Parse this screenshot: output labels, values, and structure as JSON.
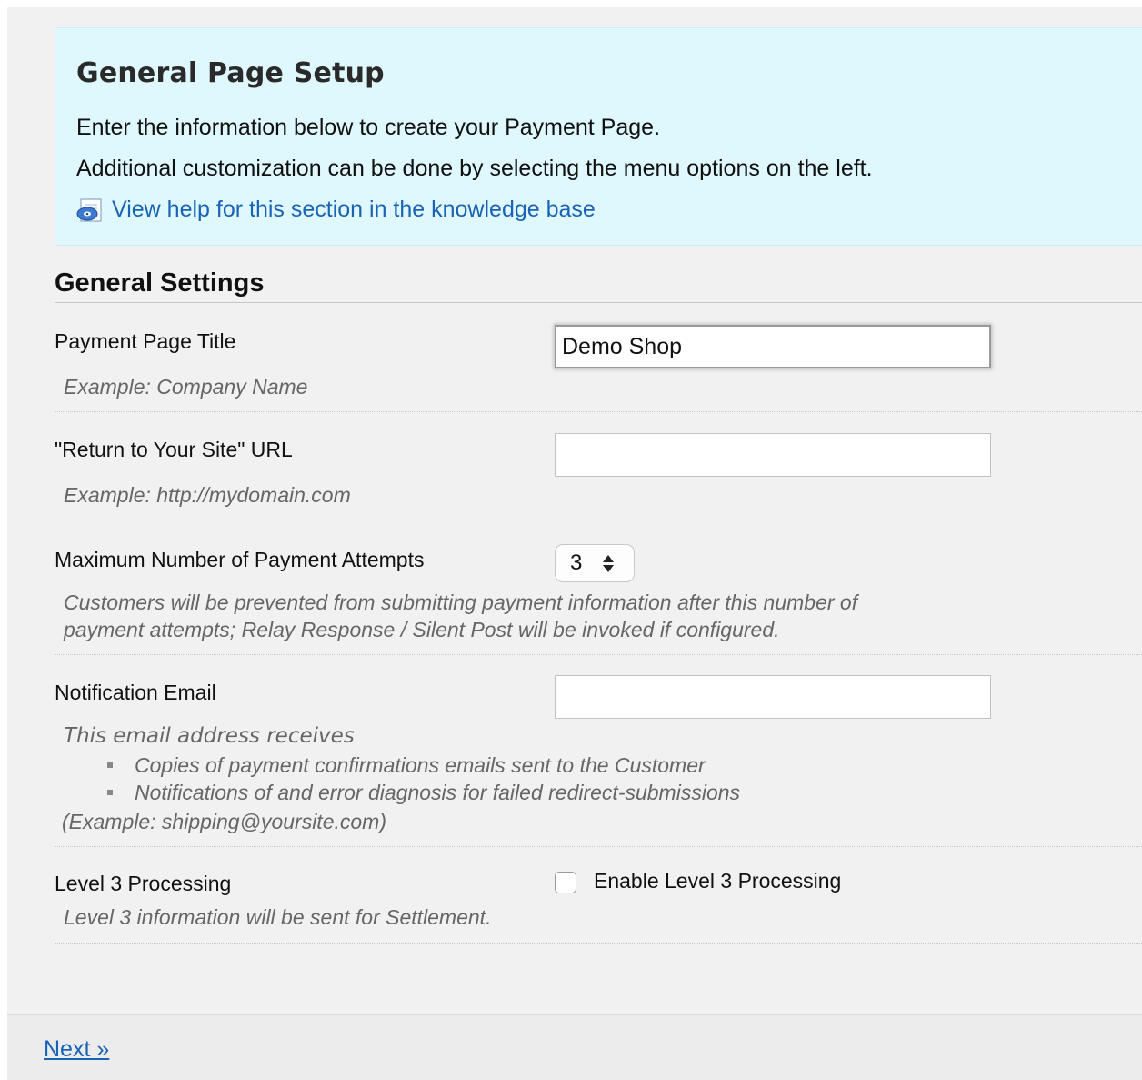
{
  "setup": {
    "title": "General Page Setup",
    "line1": "Enter the information below to create your Payment Page.",
    "line2": "Additional customization can be done by selecting the menu options on the left.",
    "help_link": "View help for this section in the knowledge base",
    "help_icon": "help-document-icon"
  },
  "section": {
    "title": "General Settings"
  },
  "fields": {
    "title": {
      "label": "Payment Page Title",
      "hint": "Example: Company Name",
      "value": "Demo Shop"
    },
    "return_url": {
      "label": "\"Return to Your Site\" URL",
      "hint": "Example: http://mydomain.com",
      "value": ""
    },
    "max_attempts": {
      "label": "Maximum Number of Payment Attempts",
      "value": "3",
      "hint_line1": "Customers will be prevented from submitting payment information after this number of",
      "hint_line2": "payment attempts; Relay Response / Silent Post will be invoked if configured."
    },
    "notification_email": {
      "label": "Notification Email",
      "value": "",
      "hint_head": "This email address receives",
      "bullets": [
        "Copies of payment confirmations emails sent to the Customer",
        "Notifications of and error diagnosis for failed redirect-submissions"
      ],
      "example": "(Example: shipping@yoursite.com)"
    },
    "level3": {
      "label": "Level 3 Processing",
      "checkbox_label": "Enable Level 3 Processing",
      "checked": false,
      "hint": "Level 3 information will be sent for Settlement."
    }
  },
  "footer": {
    "next_label": "Next »"
  },
  "colors": {
    "setup_bg": "#dff8fe",
    "page_bg": "#f1f1f1",
    "link": "#1a63b4",
    "hint": "#666666"
  }
}
